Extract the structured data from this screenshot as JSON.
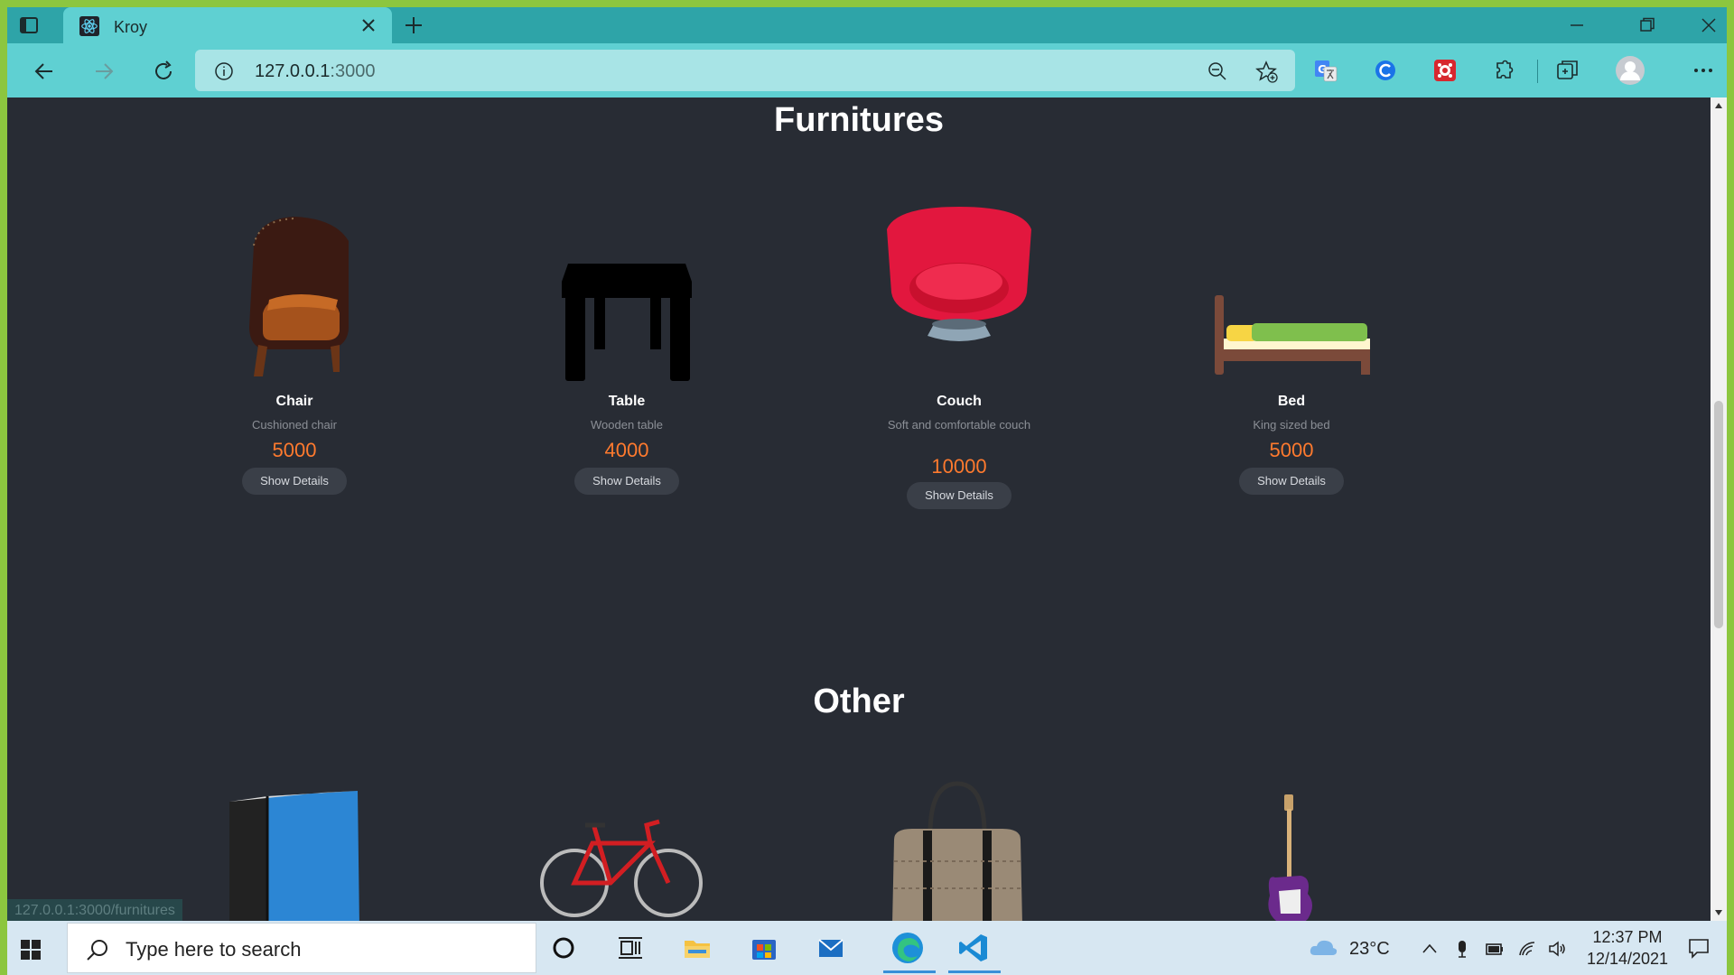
{
  "browser": {
    "tab_title": "Kroy",
    "address_host": "127.0.0.1",
    "address_port": ":3000",
    "status_url": "127.0.0.1:3000/furnitures"
  },
  "sections": {
    "furnitures_title": "Furnitures",
    "other_title": "Other"
  },
  "furnitures": [
    {
      "name": "Chair",
      "description": "Cushioned chair",
      "price": "5000",
      "button": "Show Details"
    },
    {
      "name": "Table",
      "description": "Wooden table",
      "price": "4000",
      "button": "Show Details"
    },
    {
      "name": "Couch",
      "description": "Soft and comfortable couch",
      "price": "10000",
      "button": "Show Details"
    },
    {
      "name": "Bed",
      "description": "King sized bed",
      "price": "5000",
      "button": "Show Details"
    }
  ],
  "other_items": [
    "book-image",
    "bicycle-image",
    "handbag-image",
    "guitar-image"
  ],
  "taskbar": {
    "search_placeholder": "Type here to search",
    "temperature": "23°C",
    "time": "12:37 PM",
    "date": "12/14/2021"
  },
  "colors": {
    "page_bg": "#282c34",
    "price": "#ff7a2e",
    "browser_accent": "#5fd0d2"
  }
}
